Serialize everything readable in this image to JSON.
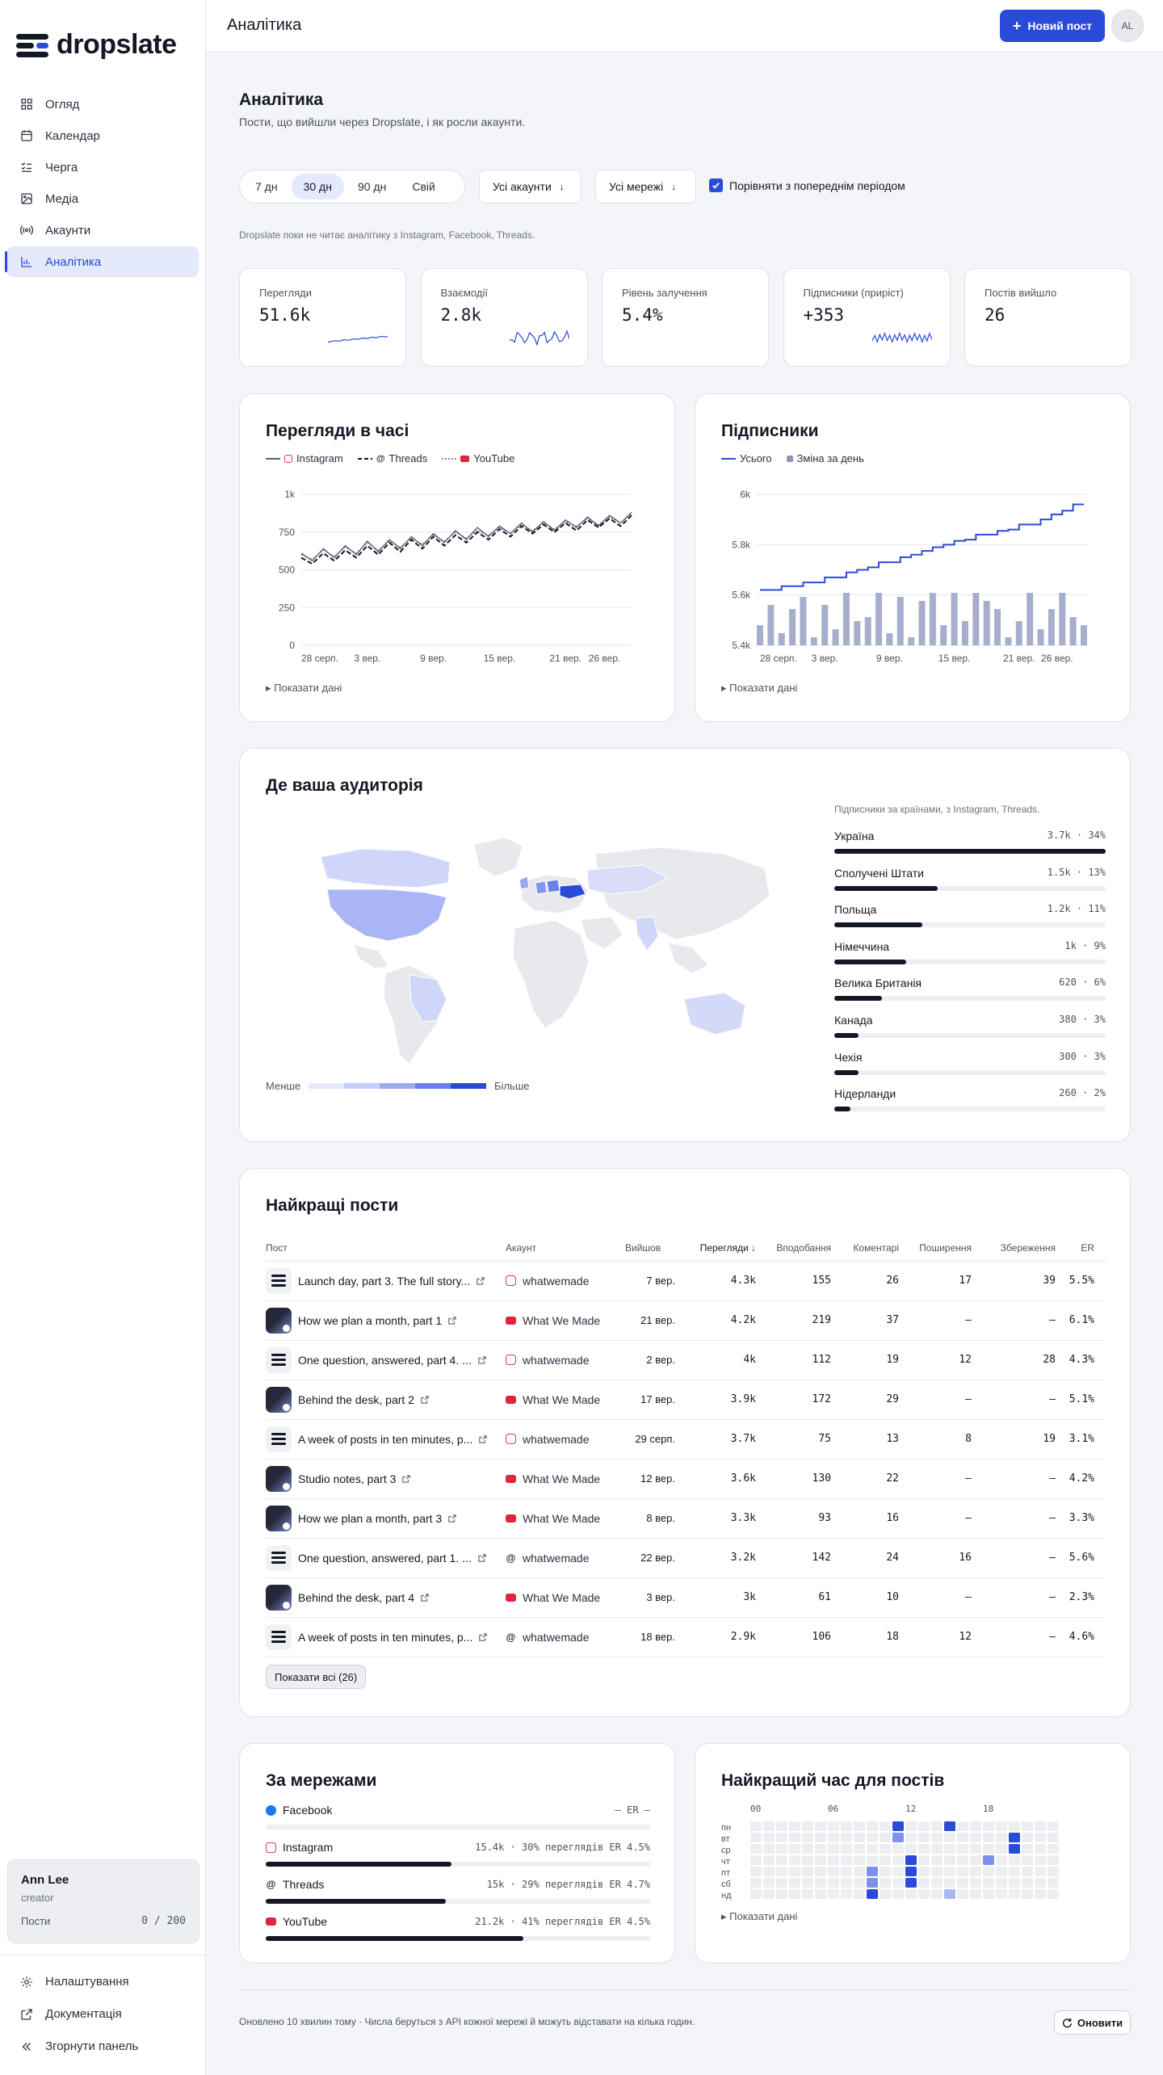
{
  "app": {
    "name": "dropslate"
  },
  "sidebar": {
    "items": [
      {
        "label": "Огляд",
        "icon": "grid-icon"
      },
      {
        "label": "Календар",
        "icon": "calendar-icon"
      },
      {
        "label": "Черга",
        "icon": "list-check-icon"
      },
      {
        "label": "Медіа",
        "icon": "image-icon"
      },
      {
        "label": "Акаунти",
        "icon": "broadcast-icon"
      },
      {
        "label": "Аналітика",
        "icon": "bar-chart-icon",
        "active": true
      }
    ],
    "user": {
      "name": "Ann Lee",
      "role": "creator",
      "posts_label": "Пости",
      "posts_value": "0 / 200"
    },
    "bottom": [
      {
        "label": "Налаштування",
        "icon": "gear-icon"
      },
      {
        "label": "Документація",
        "icon": "external-link-icon"
      },
      {
        "label": "Згорнути панель",
        "icon": "double-chevron-left-icon"
      }
    ]
  },
  "topbar": {
    "title": "Аналітика",
    "new_post": "Новий пост",
    "avatar": "AL"
  },
  "header": {
    "title": "Аналітика",
    "subtitle": "Пости, що вийшли через Dropslate, і як росли акаунти."
  },
  "filters": {
    "ranges": [
      "7 дн",
      "30 дн",
      "90 дн",
      "Свій"
    ],
    "active_range": 1,
    "accounts": "Усі акаунти",
    "networks": "Усі мережі",
    "compare": "Порівняти з попереднім періодом",
    "compare_checked": true
  },
  "notice": "Dropslate поки не читає аналітику з Instagram, Facebook, Threads.",
  "kpis": [
    {
      "label": "Перегляди",
      "value": "51.6k",
      "spark": "line"
    },
    {
      "label": "Взаємодії",
      "value": "2.8k",
      "spark": "wave"
    },
    {
      "label": "Рівень залучення",
      "value": "5.4%",
      "spark": "none"
    },
    {
      "label": "Підписники (приріст)",
      "value": "+353",
      "spark": "zigzag"
    },
    {
      "label": "Постів вийшло",
      "value": "26",
      "spark": "none"
    }
  ],
  "views_chart": {
    "title": "Перегляди в часі",
    "legend": [
      "Instagram",
      "Threads",
      "YouTube"
    ],
    "show_data": "Показати дані"
  },
  "followers_chart": {
    "title": "Підписники",
    "legend": [
      "Усього",
      "Зміна за день"
    ],
    "show_data": "Показати дані"
  },
  "chart_data": [
    {
      "type": "line",
      "x": [
        "28 серп.",
        "29 серп.",
        "30 серп.",
        "31 серп.",
        "1 вер.",
        "2 вер.",
        "3 вер.",
        "4 вер.",
        "5 вер.",
        "6 вер.",
        "7 вер.",
        "8 вер.",
        "9 вер.",
        "10 вер.",
        "11 вер.",
        "12 вер.",
        "13 вер.",
        "14 вер.",
        "15 вер.",
        "16 вер.",
        "17 вер.",
        "18 вер.",
        "19 вер.",
        "20 вер.",
        "21 вер.",
        "22 вер.",
        "23 вер.",
        "24 вер.",
        "25 вер.",
        "26 вер.",
        "27 вер."
      ],
      "xticks": [
        "28 серп.",
        "3 вер.",
        "9 вер.",
        "15 вер.",
        "21 вер.",
        "26 вер."
      ],
      "series": [
        {
          "name": "Instagram",
          "values": [
            610,
            560,
            640,
            580,
            660,
            600,
            690,
            620,
            700,
            640,
            720,
            660,
            740,
            680,
            760,
            700,
            780,
            720,
            790,
            740,
            810,
            750,
            820,
            760,
            830,
            780,
            850,
            790,
            860,
            810,
            880
          ]
        },
        {
          "name": "Threads",
          "values": [
            580,
            540,
            610,
            560,
            630,
            580,
            660,
            600,
            680,
            620,
            700,
            640,
            720,
            660,
            730,
            680,
            750,
            700,
            770,
            720,
            790,
            740,
            800,
            750,
            810,
            760,
            830,
            780,
            840,
            790,
            860
          ]
        },
        {
          "name": "YouTube",
          "values": [
            600,
            570,
            630,
            590,
            650,
            610,
            680,
            630,
            690,
            650,
            710,
            670,
            730,
            690,
            750,
            710,
            760,
            730,
            780,
            740,
            800,
            760,
            810,
            770,
            820,
            790,
            840,
            800,
            850,
            810,
            870
          ]
        }
      ],
      "ylim": [
        0,
        1000
      ],
      "yticks": [
        "0",
        "250",
        "500",
        "750",
        "1k"
      ]
    },
    {
      "type": "bar",
      "x": [
        "28 серп.",
        "29 серп.",
        "30 серп.",
        "31 серп.",
        "1 вер.",
        "2 вер.",
        "3 вер.",
        "4 вер.",
        "5 вер.",
        "6 вер.",
        "7 вер.",
        "8 вер.",
        "9 вер.",
        "10 вер.",
        "11 вер.",
        "12 вер.",
        "13 вер.",
        "14 вер.",
        "15 вер.",
        "16 вер.",
        "17 вер.",
        "18 вер.",
        "19 вер.",
        "20 вер.",
        "21 вер.",
        "22 вер.",
        "23 вер.",
        "24 вер.",
        "25 вер.",
        "26 вер.",
        "27 вер."
      ],
      "xticks": [
        "28 серп.",
        "3 вер.",
        "9 вер.",
        "15 вер.",
        "21 вер.",
        "26 вер."
      ],
      "series": [
        {
          "name": "Усього",
          "type": "line",
          "values": [
            5620,
            5620,
            5635,
            5635,
            5650,
            5650,
            5670,
            5670,
            5690,
            5700,
            5710,
            5730,
            5730,
            5750,
            5760,
            5775,
            5790,
            5800,
            5815,
            5820,
            5840,
            5840,
            5855,
            5860,
            5880,
            5880,
            5900,
            5920,
            5935,
            5960,
            5960
          ]
        },
        {
          "name": "Зміна за день",
          "type": "bar",
          "values": [
            5,
            10,
            3,
            9,
            12,
            2,
            10,
            4,
            13,
            6,
            7,
            13,
            3,
            12,
            2,
            11,
            13,
            5,
            13,
            6,
            13,
            11,
            9,
            2,
            6,
            13,
            4,
            9,
            13,
            7,
            5
          ]
        }
      ],
      "ylim": [
        5400,
        6000
      ],
      "yticks": [
        "5.4k",
        "5.6k",
        "5.8k",
        "6k"
      ]
    }
  ],
  "audience": {
    "title": "Де ваша аудиторія",
    "caption": "Підписники за країнами, з Instagram, Threads.",
    "legend_less": "Менше",
    "legend_more": "Більше",
    "countries": [
      {
        "name": "Україна",
        "count": "3.7k",
        "pct": "34%",
        "share": 34
      },
      {
        "name": "Сполучені Штати",
        "count": "1.5k",
        "pct": "13%",
        "share": 13
      },
      {
        "name": "Польща",
        "count": "1.2k",
        "pct": "11%",
        "share": 11
      },
      {
        "name": "Німеччина",
        "count": "1k",
        "pct": "9%",
        "share": 9
      },
      {
        "name": "Велика Британія",
        "count": "620",
        "pct": "6%",
        "share": 6
      },
      {
        "name": "Канада",
        "count": "380",
        "pct": "3%",
        "share": 3
      },
      {
        "name": "Чехія",
        "count": "300",
        "pct": "3%",
        "share": 3
      },
      {
        "name": "Нідерланди",
        "count": "260",
        "pct": "2%",
        "share": 2
      }
    ]
  },
  "top_posts": {
    "title": "Найкращі пости",
    "headers": [
      "Пост",
      "Акаунт",
      "Вийшов",
      "Перегляди",
      "Вподобання",
      "Коментарі",
      "Поширення",
      "Збереження",
      "ER"
    ],
    "rows": [
      {
        "post": "Launch day, part 3. The full story...",
        "thumb": "logo",
        "net": "instagram",
        "account": "whatwemade",
        "date": "7 вер.",
        "views": "4.3k",
        "likes": "155",
        "comments": "26",
        "shares": "17",
        "saves": "39",
        "er": "5.5%"
      },
      {
        "post": "How we plan a month, part 1",
        "thumb": "photo",
        "net": "youtube",
        "account": "What We Made",
        "date": "21 вер.",
        "views": "4.2k",
        "likes": "219",
        "comments": "37",
        "shares": "—",
        "saves": "—",
        "er": "6.1%"
      },
      {
        "post": "One question, answered, part 4. ...",
        "thumb": "logo",
        "net": "instagram",
        "account": "whatwemade",
        "date": "2 вер.",
        "views": "4k",
        "likes": "112",
        "comments": "19",
        "shares": "12",
        "saves": "28",
        "er": "4.3%"
      },
      {
        "post": "Behind the desk, part 2",
        "thumb": "photo",
        "net": "youtube",
        "account": "What We Made",
        "date": "17 вер.",
        "views": "3.9k",
        "likes": "172",
        "comments": "29",
        "shares": "—",
        "saves": "—",
        "er": "5.1%"
      },
      {
        "post": "A week of posts in ten minutes, p...",
        "thumb": "logo",
        "net": "instagram",
        "account": "whatwemade",
        "date": "29 серп.",
        "views": "3.7k",
        "likes": "75",
        "comments": "13",
        "shares": "8",
        "saves": "19",
        "er": "3.1%"
      },
      {
        "post": "Studio notes, part 3",
        "thumb": "photo",
        "net": "youtube",
        "account": "What We Made",
        "date": "12 вер.",
        "views": "3.6k",
        "likes": "130",
        "comments": "22",
        "shares": "—",
        "saves": "—",
        "er": "4.2%"
      },
      {
        "post": "How we plan a month, part 3",
        "thumb": "photo",
        "net": "youtube",
        "account": "What We Made",
        "date": "8 вер.",
        "views": "3.3k",
        "likes": "93",
        "comments": "16",
        "shares": "—",
        "saves": "—",
        "er": "3.3%"
      },
      {
        "post": "One question, answered, part 1. ...",
        "thumb": "logo",
        "net": "threads",
        "account": "whatwemade",
        "date": "22 вер.",
        "views": "3.2k",
        "likes": "142",
        "comments": "24",
        "shares": "16",
        "saves": "—",
        "er": "5.6%"
      },
      {
        "post": "Behind the desk, part 4",
        "thumb": "photo",
        "net": "youtube",
        "account": "What We Made",
        "date": "3 вер.",
        "views": "3k",
        "likes": "61",
        "comments": "10",
        "shares": "—",
        "saves": "—",
        "er": "2.3%"
      },
      {
        "post": "A week of posts in ten minutes, p...",
        "thumb": "logo",
        "net": "threads",
        "account": "whatwemade",
        "date": "18 вер.",
        "views": "2.9k",
        "likes": "106",
        "comments": "18",
        "shares": "12",
        "saves": "—",
        "er": "4.6%"
      }
    ],
    "show_all": "Показати всі (26)"
  },
  "networks": {
    "title": "За мережами",
    "rows": [
      {
        "name": "Facebook",
        "net": "facebook",
        "stat": "— ER —",
        "share": 0
      },
      {
        "name": "Instagram",
        "net": "instagram",
        "stat": "15.4k · 30% переглядів ER 4.5%",
        "share": 72
      },
      {
        "name": "Threads",
        "net": "threads",
        "stat": "15k · 29% переглядів ER 4.7%",
        "share": 70
      },
      {
        "name": "YouTube",
        "net": "youtube",
        "stat": "21.2k · 41% переглядів ER 4.5%",
        "share": 100
      }
    ]
  },
  "best_time": {
    "title": "Найкращий час для постів",
    "hours": [
      "00",
      "06",
      "12",
      "18"
    ],
    "days": [
      "пн",
      "вт",
      "ср",
      "чт",
      "пт",
      "сб",
      "нд"
    ],
    "cells": [
      {
        "day": 0,
        "hour": 11,
        "level": 3
      },
      {
        "day": 0,
        "hour": 15,
        "level": 3
      },
      {
        "day": 1,
        "hour": 11,
        "level": 2
      },
      {
        "day": 1,
        "hour": 20,
        "level": 3
      },
      {
        "day": 2,
        "hour": 20,
        "level": 3
      },
      {
        "day": 3,
        "hour": 12,
        "level": 3
      },
      {
        "day": 3,
        "hour": 18,
        "level": 2
      },
      {
        "day": 4,
        "hour": 9,
        "level": 2
      },
      {
        "day": 4,
        "hour": 12,
        "level": 3
      },
      {
        "day": 5,
        "hour": 9,
        "level": 2
      },
      {
        "day": 5,
        "hour": 12,
        "level": 3
      },
      {
        "day": 6,
        "hour": 9,
        "level": 3
      },
      {
        "day": 6,
        "hour": 15,
        "level": 1
      }
    ],
    "show_data": "Показати дані"
  },
  "footer": {
    "text": "Оновлено 10 хвилин тому · Числа беруться з API кожної мережі й можуть відставати на кілька годин.",
    "refresh": "Оновити"
  },
  "colors": {
    "accent": "#2a4bd7",
    "instagram": "#e1306c",
    "youtube": "#e0243a",
    "threads": "#141824",
    "facebook": "#1877f2",
    "ink": "#141824"
  }
}
